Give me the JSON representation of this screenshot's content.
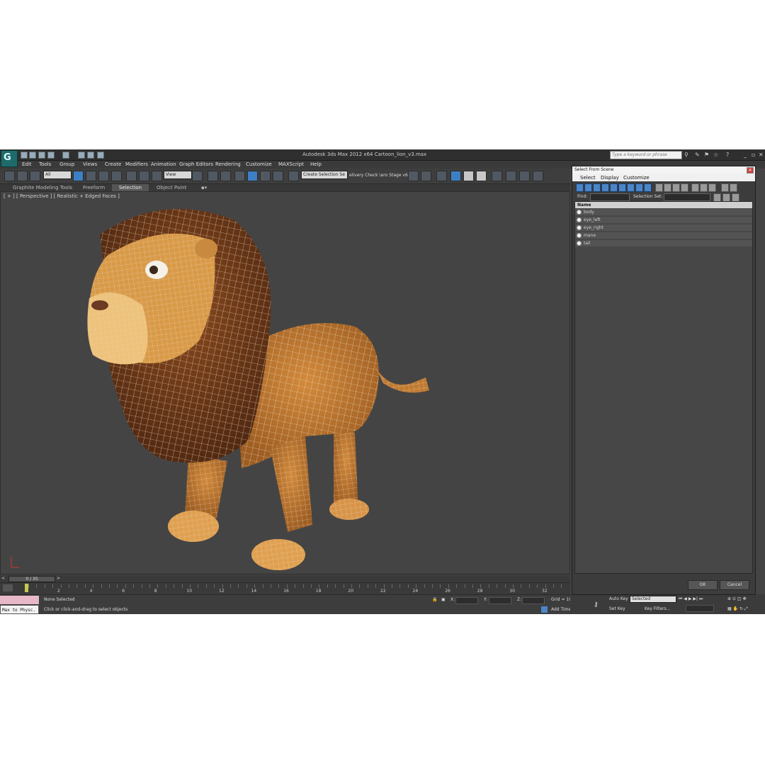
{
  "app": {
    "title": "Autodesk 3ds Max  2012 x64       Cartoon_lion_v3.max",
    "search_placeholder": "Type a keyword or phrase",
    "help_icon": "?"
  },
  "menu": [
    "Edit",
    "Tools",
    "Group",
    "Views",
    "Create",
    "Modifiers",
    "Animation",
    "Graph Editors",
    "Rendering",
    "Customize",
    "MAXScript",
    "Help"
  ],
  "toolbar": {
    "filter_value": "All",
    "view_value": "View",
    "selection_set_value": "Create Selection Se",
    "extra_text": "elivery Check  \\ero Stage v6"
  },
  "ribbon_tabs": [
    "Graphite Modeling Tools",
    "Freeform",
    "Selection",
    "Object Paint"
  ],
  "viewport": {
    "label": "[ + ] [ Perspective ] [ Realistic + Edged Faces ]"
  },
  "timeline": {
    "frame_readout": "0 / 35",
    "ticks": [
      "2",
      "4",
      "6",
      "8",
      "10",
      "12",
      "14",
      "16",
      "18",
      "20",
      "22",
      "24",
      "26",
      "28",
      "30",
      "32"
    ]
  },
  "status": {
    "selection": "None Selected",
    "prompt": "Click or click-and-drag to select objects",
    "maxscript": "Max to Physc.",
    "x_label": "X:",
    "y_label": "Y:",
    "z_label": "Z:",
    "grid": "Grid = 10,0cm",
    "add_time_tag": "Add Time Tag",
    "auto_key": "Auto Key",
    "set_key": "Set Key",
    "key_mode": "Selected",
    "key_filters": "Key Filters..."
  },
  "dialog": {
    "title": "Select From Scene",
    "menu": [
      "Select",
      "Display",
      "Customize"
    ],
    "find_label": "Find:",
    "selection_set_label": "Selection Set:",
    "column_header": "Name",
    "objects": [
      "body",
      "eye_left",
      "eye_right",
      "mane",
      "tail"
    ],
    "ok": "OK",
    "cancel": "Cancel"
  }
}
